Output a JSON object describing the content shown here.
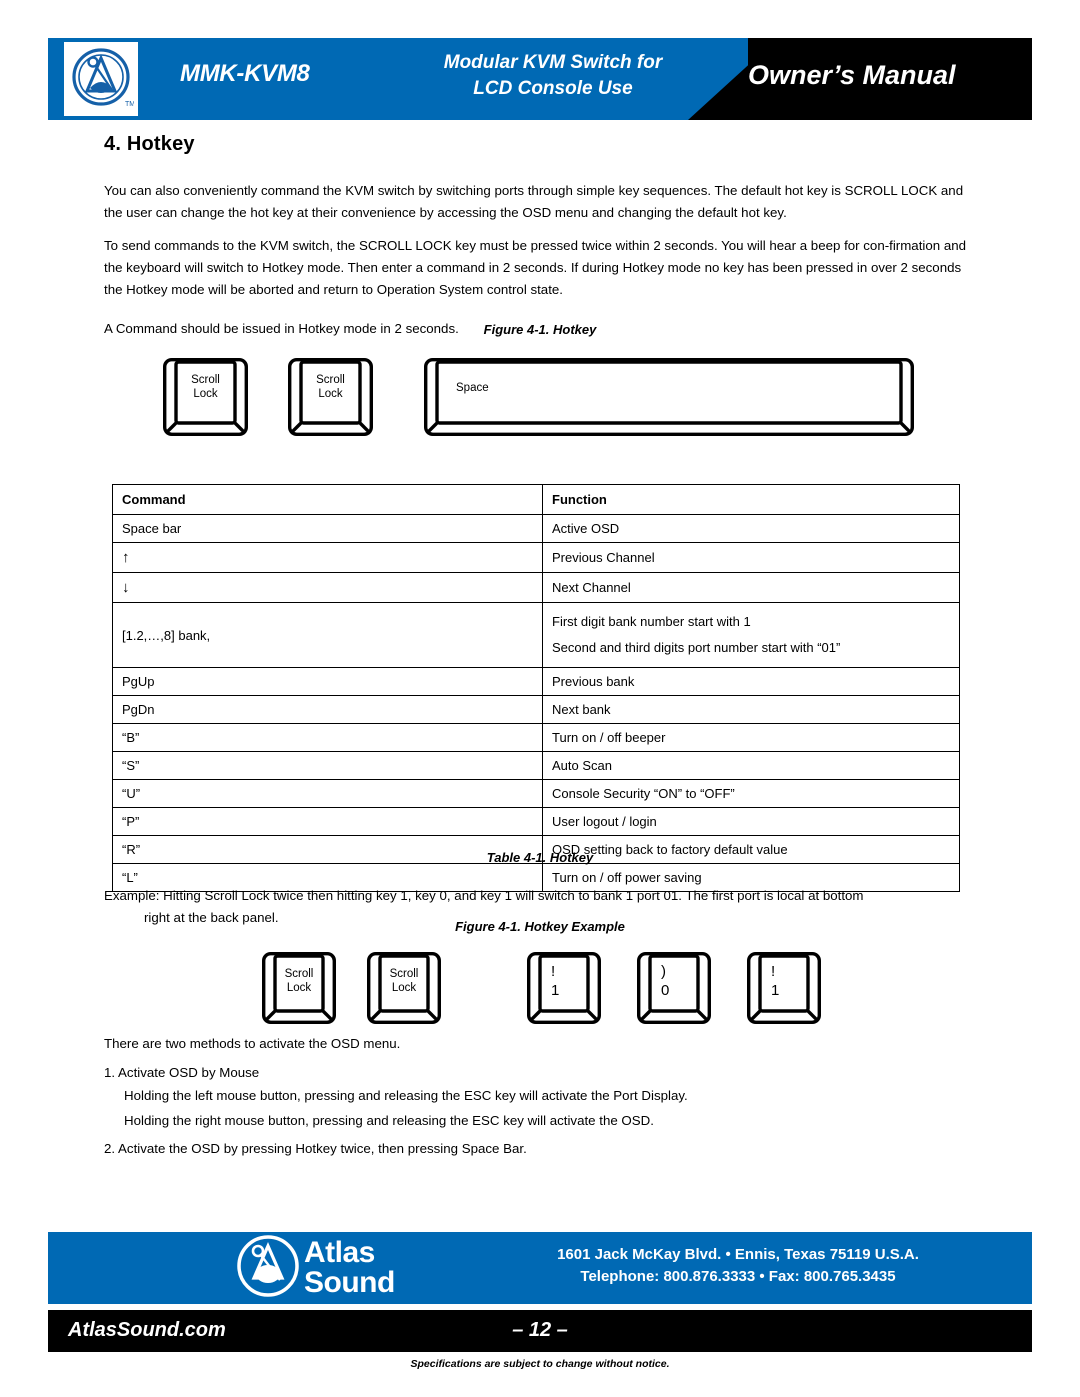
{
  "header": {
    "model": "MMK-KVM8",
    "subtitle_line1": "Modular KVM Switch for",
    "subtitle_line2": "LCD Console Use",
    "owners_manual": "Owner’s Manual",
    "logo_icon": "atlas-sound-a-logo-icon",
    "blue": "#0069B4",
    "black": "#000000"
  },
  "section": {
    "title": "4.  Hotkey",
    "paragraph1": "You can also conveniently command the KVM switch by switching ports through simple key sequences. The default hot key is SCROLL LOCK and the user can change the hot key at their convenience by accessing the OSD menu and changing the default hot key.",
    "paragraph2": "To send commands to the KVM switch, the SCROLL LOCK key must be pressed twice within 2 seconds. You will hear a beep for con-firmation and the keyboard will switch to Hotkey mode. Then enter a command in 2 seconds. If during Hotkey mode no key has been pressed in over 2 seconds the Hotkey mode will be aborted and return to Operation System control state.",
    "paragraph3": "A Command should be issued in Hotkey mode in 2 seconds."
  },
  "figure1": {
    "caption": "Figure 4-1. Hotkey",
    "keys": [
      {
        "label": "Scroll\nLock",
        "name": "scroll-lock-key"
      },
      {
        "label": "Scroll\nLock",
        "name": "scroll-lock-key"
      },
      {
        "label": "Space",
        "name": "space-bar-key"
      }
    ]
  },
  "table": {
    "caption": "Table 4-1. Hotkey",
    "headers": [
      "Command",
      "Function"
    ],
    "rows": [
      {
        "command": "Space bar",
        "function": "Active OSD"
      },
      {
        "command": "↑",
        "function": "Previous Channel"
      },
      {
        "command": "↓",
        "function": "Next Channel"
      },
      {
        "command": "[1.2,…,8] bank,",
        "function": "First digit bank number start with 1\nSecond and third digits port number start with “01”"
      },
      {
        "command": "PgUp",
        "function": "Previous bank"
      },
      {
        "command": "PgDn",
        "function": "Next bank"
      },
      {
        "command": "“B”",
        "function": "Turn on / off beeper"
      },
      {
        "command": "“S”",
        "function": "Auto Scan"
      },
      {
        "command": "“U”",
        "function": "Console Security “ON” to “OFF”"
      },
      {
        "command": "“P”",
        "function": "User logout / login"
      },
      {
        "command": "“R”",
        "function": "OSD setting back to factory default value"
      },
      {
        "command": "“L”",
        "function": "Turn on / off power saving"
      }
    ]
  },
  "example": {
    "text": "Example: Hitting Scroll Lock twice then hitting key 1, key 0, and key 1 will switch to bank 1 port 01. The first port is local at bottom",
    "text_indent": "right at the back panel.",
    "caption": "Figure 4-1. Hotkey Example",
    "keys": [
      {
        "label": "Scroll\nLock",
        "name": "scroll-lock-key"
      },
      {
        "label": "Scroll\nLock",
        "name": "scroll-lock-key"
      },
      {
        "label": "!\n1",
        "name": "digit-1-key"
      },
      {
        "label": ")\n0",
        "name": "digit-0-key"
      },
      {
        "label": "!\n1",
        "name": "digit-1-key"
      }
    ]
  },
  "osd": {
    "intro": "There are two methods to activate the OSD menu.",
    "item1": "1. Activate OSD by Mouse",
    "item1a": "Holding the left mouse button, pressing and releasing the ESC key will activate the Port Display.",
    "item1b": "Holding the right mouse button, pressing and releasing the ESC key will activate the OSD.",
    "item2": "2. Activate the OSD by pressing Hotkey twice, then pressing Space Bar."
  },
  "footer": {
    "brand_line1": "Atlas",
    "brand_line2": "Sound",
    "logo_icon": "atlas-sound-a-logo-icon",
    "address_line1": "1601 Jack McKay Blvd. • Ennis, Texas 75119  U.S.A.",
    "address_line2": "Telephone: 800.876.3333 • Fax: 800.765.3435",
    "website": "AtlasSound.com",
    "page_number": "– 12 –",
    "disclaimer": "Specifications are subject to change without notice."
  }
}
